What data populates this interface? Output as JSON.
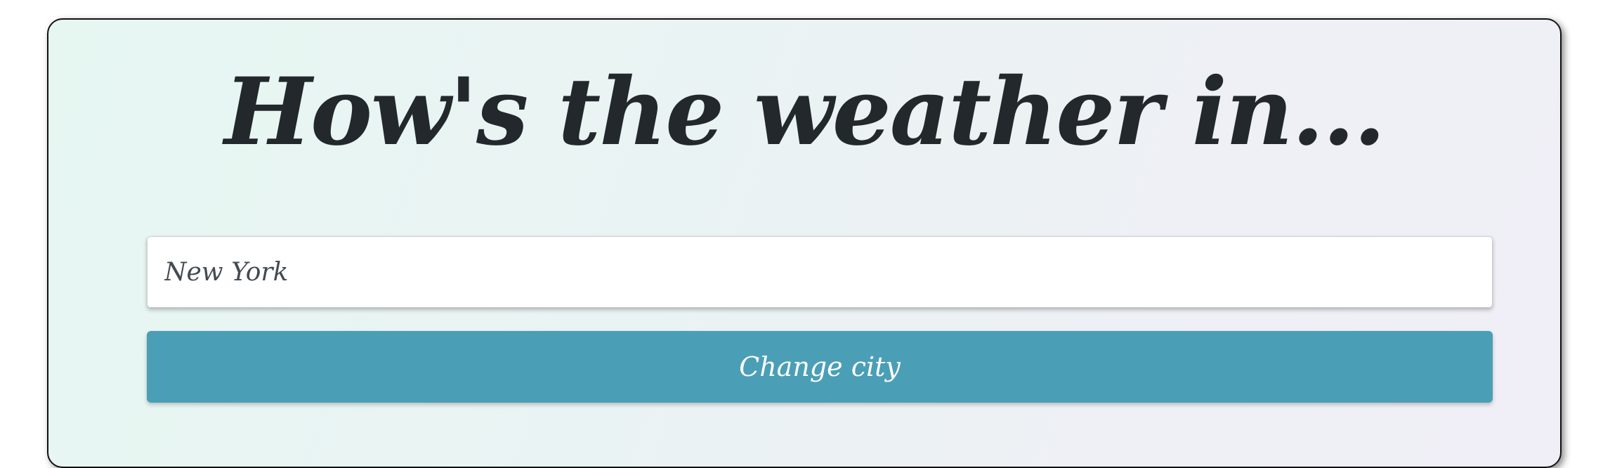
{
  "header": {
    "title": "How's the weather in..."
  },
  "search": {
    "value": "New York",
    "placeholder": ""
  },
  "actions": {
    "change_city_label": "Change city"
  },
  "colors": {
    "button_background": "#4a9fb6",
    "title_text": "#23282c",
    "card_gradient_start": "#e6f7f2",
    "card_gradient_end": "#f0eef6"
  }
}
